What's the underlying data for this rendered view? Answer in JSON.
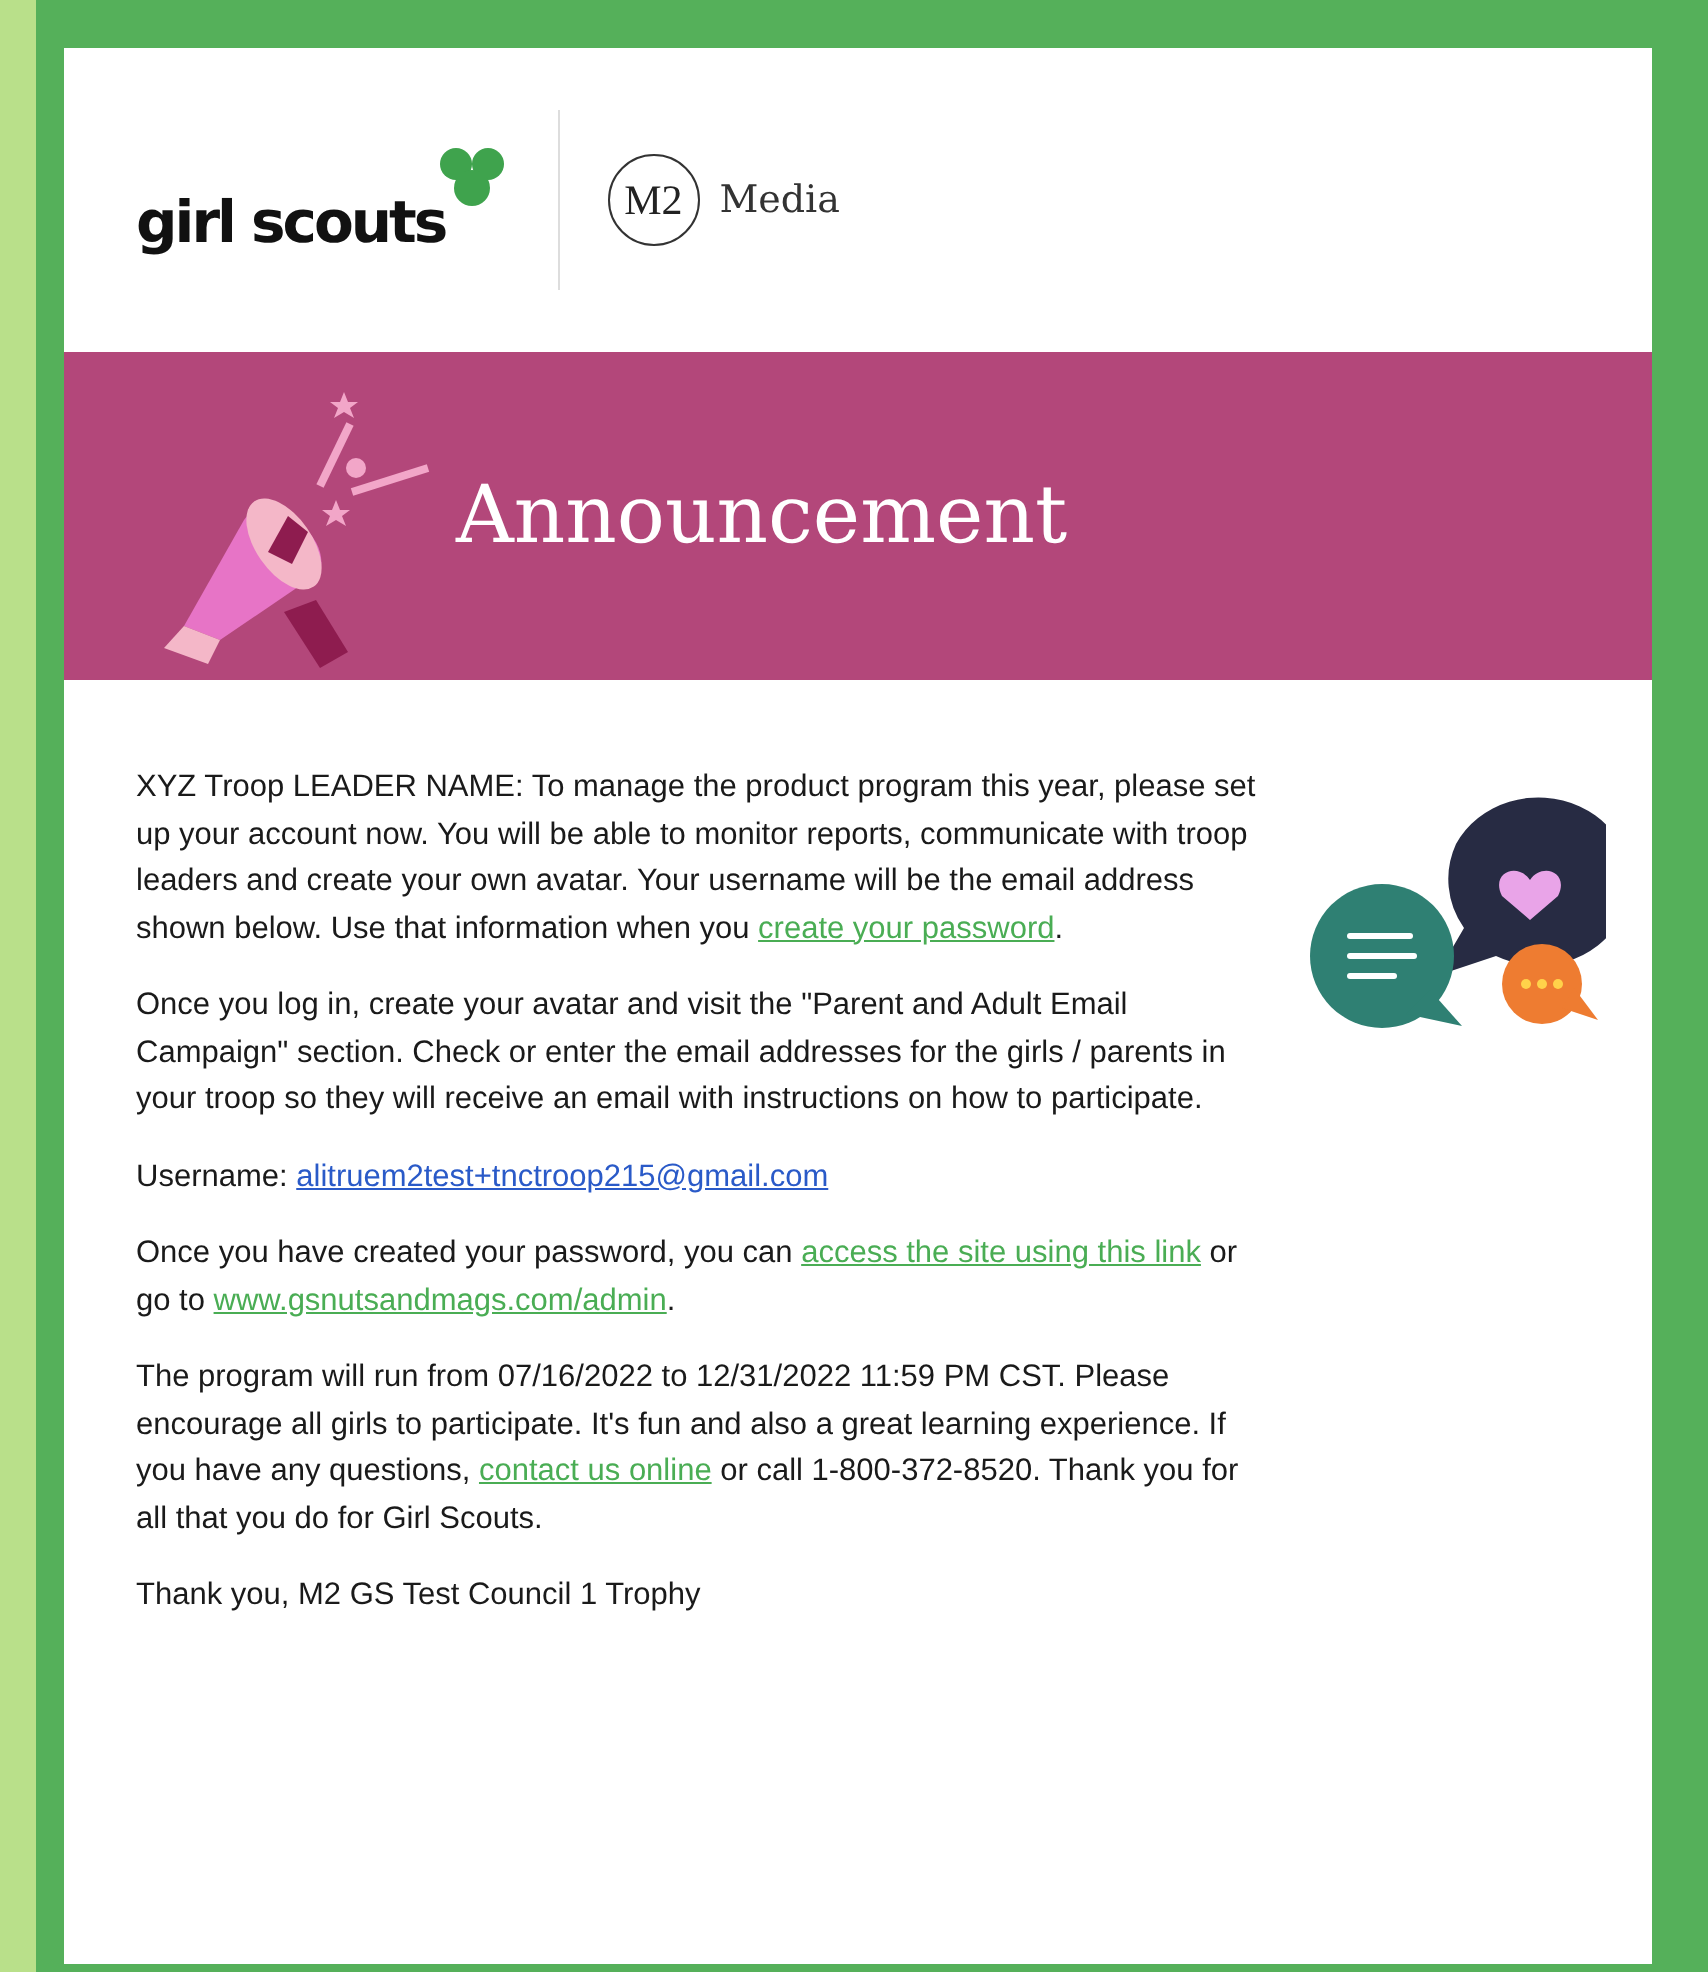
{
  "header": {
    "logo_text": "girl scouts",
    "partner_mark": "M2",
    "partner_name": "Media"
  },
  "banner": {
    "title": "Announcement"
  },
  "paragraphs": [
    {
      "segments": [
        {
          "kind": "text",
          "text": "XYZ Troop LEADER NAME: To manage the product program this year, please set up your account now. You will be able to monitor reports, communicate with troop leaders and create your own avatar. Your username will be the email address shown below. Use that information when you "
        },
        {
          "kind": "link",
          "text": "create your password"
        },
        {
          "kind": "text",
          "text": "."
        }
      ]
    },
    {
      "segments": [
        {
          "kind": "text",
          "text": "Once you log in, create your avatar and visit the \"Parent and Adult Email Campaign\" section. Check or enter the email addresses for the girls / parents in your troop so they will receive an email with instructions on how to participate."
        }
      ]
    },
    {
      "segments": [
        {
          "kind": "text",
          "text": "Username: "
        },
        {
          "kind": "email",
          "text": "alitruem2test+tnctroop215@gmail.com"
        }
      ]
    },
    {
      "segments": [
        {
          "kind": "text",
          "text": "Once you have created your password, you can "
        },
        {
          "kind": "link",
          "text": "access the site using this link"
        },
        {
          "kind": "text",
          "text": " or go to "
        },
        {
          "kind": "link",
          "text": "www.gsnutsandmags.com/admin"
        },
        {
          "kind": "text",
          "text": "."
        }
      ]
    },
    {
      "segments": [
        {
          "kind": "text",
          "text": "The program will run from 07/16/2022 to 12/31/2022 11:59 PM CST. Please encourage all girls to participate. It's fun and also a great learning experience. If you have any questions, "
        },
        {
          "kind": "link",
          "text": "contact us online"
        },
        {
          "kind": "text",
          "text": " or call 1-800-372-8520. Thank you for all that you do for Girl Scouts."
        }
      ]
    },
    {
      "segments": [
        {
          "kind": "text",
          "text": "Thank you, M2 GS Test Council 1 Trophy"
        }
      ]
    }
  ]
}
